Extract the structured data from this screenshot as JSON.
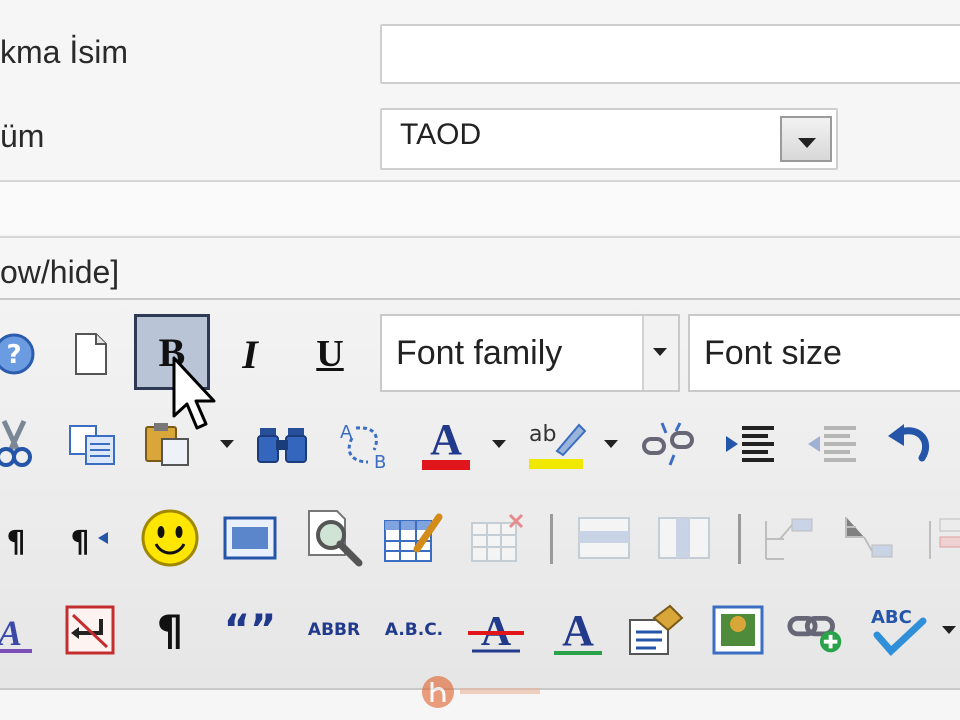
{
  "form": {
    "alias_label": "kma İsim",
    "alias_value": "",
    "section_label": "üm",
    "section_value": "TAOD",
    "toggle_editor_label": "ow/hide]"
  },
  "toolbar": {
    "font_family_label": "Font family",
    "font_size_label": "Font size",
    "bold_label": "B",
    "italic_label": "I",
    "underline_label": "U",
    "pilcrow_label": "¶",
    "quote_label": "“”",
    "abbr_label": "ABBR",
    "acronym_label": "A.B.C.",
    "spell_label": "ABC"
  },
  "colors": {
    "accent": "#2e3a53",
    "font_color": "#e0161b",
    "highlight": "#f0e800",
    "icon_blue": "#2455a8"
  },
  "icons": [
    "help-icon",
    "new-document-icon",
    "bold-icon",
    "italic-icon",
    "underline-icon",
    "cut-icon",
    "copy-icon",
    "paste-icon",
    "find-icon",
    "replace-icon",
    "font-color-icon",
    "highlight-color-icon",
    "unlink-icon",
    "indent-icon",
    "outdent-icon",
    "undo-icon",
    "ltr-icon",
    "rtl-icon",
    "emoticon-icon",
    "insert-layer-icon",
    "preview-icon",
    "table-icon",
    "delete-table-icon",
    "row-icon",
    "column-icon",
    "cell-split-icon",
    "cell-merge-icon",
    "style-icon",
    "page-break-icon",
    "paragraph-icon",
    "quote-icon",
    "abbr-icon",
    "acronym-icon",
    "strikethrough-icon",
    "text-style-icon",
    "template-icon",
    "image-icon",
    "link-icon",
    "spellcheck-icon"
  ]
}
